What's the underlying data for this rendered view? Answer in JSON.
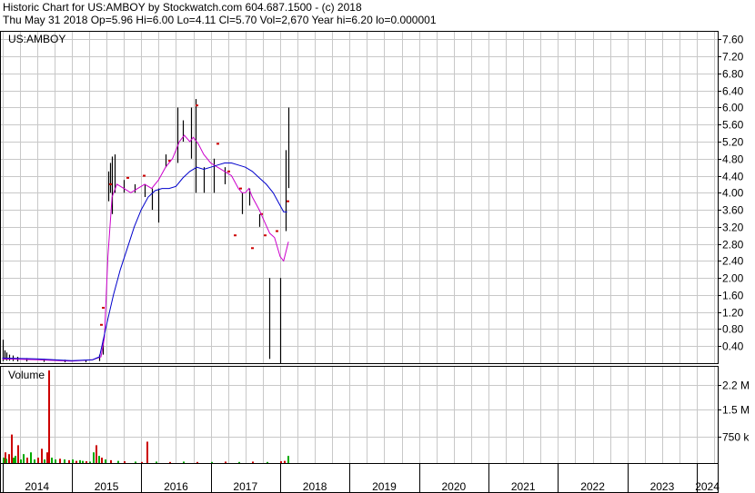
{
  "header": {
    "line1": "Historic Chart for US:AMBOY by Stockwatch.com 604.687.1500 - (c) 2018",
    "line2": "Thu May 31 2018  Op=5.96  Hi=6.00  Lo=4.11  Cl=5.70  Vol=2,670  Year hi=6.20  lo=0.000001"
  },
  "chart_data": {
    "type": "ohlc",
    "symbol_label": "US:AMBOY",
    "volume_label": "Volume",
    "price_axis": {
      "min": 0,
      "max": 7.8,
      "ticks": [
        0.4,
        0.8,
        1.2,
        1.6,
        2.0,
        2.4,
        2.8,
        3.2,
        3.6,
        4.0,
        4.4,
        4.8,
        5.2,
        5.6,
        6.0,
        6.4,
        6.8,
        7.2,
        7.6
      ],
      "tick_labels": [
        "0.40",
        "0.80",
        "1.20",
        "1.60",
        "2.00",
        "2.40",
        "2.80",
        "3.20",
        "3.60",
        "4.00",
        "4.40",
        "4.80",
        "5.20",
        "5.60",
        "6.00",
        "6.40",
        "6.80",
        "7.20",
        "7.60"
      ]
    },
    "volume_axis": {
      "min": 0,
      "max": 2600000,
      "ticks": [
        750000,
        1500000,
        2200000
      ],
      "tick_labels": [
        "750 k",
        "1.5 M",
        "2.2 M"
      ]
    },
    "time_axis": {
      "start": 2013.98,
      "end": 2024.3,
      "year_labels": [
        "2014",
        "2015",
        "2016",
        "2017",
        "2018",
        "2019",
        "2020",
        "2021",
        "2022",
        "2023",
        "2024"
      ]
    },
    "grid": true,
    "price_bars": [
      {
        "t": 2014.0,
        "h": 0.55,
        "l": 0.05
      },
      {
        "t": 2014.03,
        "h": 0.3,
        "l": 0.08
      },
      {
        "t": 2014.06,
        "h": 0.25,
        "l": 0.06
      },
      {
        "t": 2014.1,
        "h": 0.2,
        "l": 0.06
      },
      {
        "t": 2014.15,
        "h": 0.18,
        "l": 0.05
      },
      {
        "t": 2014.22,
        "h": 0.15,
        "l": 0.04
      },
      {
        "t": 2014.35,
        "h": 0.12,
        "l": 0.04
      },
      {
        "t": 2014.6,
        "h": 0.1,
        "l": 0.03
      },
      {
        "t": 2014.9,
        "h": 0.08,
        "l": 0.02
      },
      {
        "t": 2015.2,
        "h": 0.06,
        "l": 0.02
      },
      {
        "t": 2015.4,
        "h": 0.2,
        "l": 0.05
      },
      {
        "t": 2015.45,
        "h": 0.55,
        "l": 0.2
      },
      {
        "t": 2015.52,
        "h": 4.5,
        "l": 3.8
      },
      {
        "t": 2015.55,
        "h": 4.7,
        "l": 4.0
      },
      {
        "t": 2015.58,
        "h": 4.85,
        "l": 3.5
      },
      {
        "t": 2015.62,
        "h": 4.9,
        "l": 4.0
      },
      {
        "t": 2015.75,
        "h": 4.3,
        "l": 4.0
      },
      {
        "t": 2015.9,
        "h": 4.2,
        "l": 4.0
      },
      {
        "t": 2016.05,
        "h": 4.2,
        "l": 3.9
      },
      {
        "t": 2016.15,
        "h": 4.1,
        "l": 3.6
      },
      {
        "t": 2016.25,
        "h": 4.1,
        "l": 3.3
      },
      {
        "t": 2016.35,
        "h": 4.9,
        "l": 4.6
      },
      {
        "t": 2016.52,
        "h": 6.0,
        "l": 4.7
      },
      {
        "t": 2016.6,
        "h": 5.7,
        "l": 5.2
      },
      {
        "t": 2016.72,
        "h": 6.0,
        "l": 4.8
      },
      {
        "t": 2016.78,
        "h": 6.2,
        "l": 4.0
      },
      {
        "t": 2016.9,
        "h": 4.6,
        "l": 4.0
      },
      {
        "t": 2017.05,
        "h": 4.8,
        "l": 4.0
      },
      {
        "t": 2017.2,
        "h": 4.6,
        "l": 4.2
      },
      {
        "t": 2017.45,
        "h": 4.0,
        "l": 3.5
      },
      {
        "t": 2017.55,
        "h": 4.1,
        "l": 3.7
      },
      {
        "t": 2017.7,
        "h": 3.5,
        "l": 3.2
      },
      {
        "t": 2017.85,
        "h": 2.0,
        "l": 0.1
      },
      {
        "t": 2018.0,
        "h": 2.0,
        "l": 0.0
      },
      {
        "t": 2018.08,
        "h": 5.0,
        "l": 3.1
      },
      {
        "t": 2018.12,
        "h": 6.0,
        "l": 4.11
      }
    ],
    "price_dots": [
      {
        "t": 2015.42,
        "v": 0.9
      },
      {
        "t": 2015.45,
        "v": 1.3
      },
      {
        "t": 2015.55,
        "v": 4.2
      },
      {
        "t": 2015.8,
        "v": 4.35
      },
      {
        "t": 2016.03,
        "v": 4.4
      },
      {
        "t": 2016.4,
        "v": 4.75
      },
      {
        "t": 2016.8,
        "v": 6.05
      },
      {
        "t": 2017.1,
        "v": 5.15
      },
      {
        "t": 2017.25,
        "v": 4.5
      },
      {
        "t": 2017.35,
        "v": 3.0
      },
      {
        "t": 2017.43,
        "v": 4.1
      },
      {
        "t": 2017.6,
        "v": 2.7
      },
      {
        "t": 2017.72,
        "v": 3.5
      },
      {
        "t": 2017.78,
        "v": 3.0
      },
      {
        "t": 2017.95,
        "v": 3.1
      },
      {
        "t": 2018.1,
        "v": 3.8
      }
    ],
    "series": [
      {
        "color": "#cc00cc",
        "t": [
          2014.0,
          2014.5,
          2015.0,
          2015.3,
          2015.42,
          2015.47,
          2015.52,
          2015.58,
          2015.65,
          2015.75,
          2015.85,
          2015.95,
          2016.05,
          2016.15,
          2016.25,
          2016.35,
          2016.45,
          2016.5,
          2016.55,
          2016.62,
          2016.7,
          2016.75,
          2016.82,
          2016.9,
          2017.0,
          2017.1,
          2017.2,
          2017.3,
          2017.4,
          2017.45,
          2017.5,
          2017.55,
          2017.6,
          2017.7,
          2017.78,
          2017.85,
          2017.92,
          2018.0,
          2018.05,
          2018.12
        ],
        "values": [
          0.1,
          0.08,
          0.05,
          0.08,
          0.15,
          0.6,
          2.5,
          3.9,
          4.2,
          4.1,
          4.0,
          4.1,
          4.2,
          4.1,
          4.3,
          4.6,
          4.8,
          5.0,
          5.2,
          5.35,
          5.2,
          5.3,
          5.15,
          4.9,
          4.7,
          4.6,
          4.5,
          4.4,
          4.1,
          4.0,
          4.0,
          4.1,
          3.9,
          3.6,
          3.3,
          3.05,
          2.95,
          2.5,
          2.4,
          2.85
        ]
      },
      {
        "color": "#0000cc",
        "t": [
          2014.0,
          2014.5,
          2015.0,
          2015.3,
          2015.4,
          2015.5,
          2015.6,
          2015.7,
          2015.8,
          2015.9,
          2016.0,
          2016.1,
          2016.2,
          2016.3,
          2016.4,
          2016.5,
          2016.6,
          2016.7,
          2016.8,
          2016.9,
          2017.0,
          2017.1,
          2017.2,
          2017.3,
          2017.4,
          2017.5,
          2017.6,
          2017.7,
          2017.8,
          2017.9,
          2018.0,
          2018.05,
          2018.1
        ],
        "values": [
          0.12,
          0.1,
          0.06,
          0.08,
          0.15,
          0.9,
          1.6,
          2.2,
          2.7,
          3.2,
          3.6,
          3.9,
          4.05,
          4.1,
          4.1,
          4.15,
          4.35,
          4.5,
          4.6,
          4.55,
          4.6,
          4.65,
          4.7,
          4.7,
          4.65,
          4.6,
          4.5,
          4.35,
          4.2,
          4.0,
          3.7,
          3.55,
          3.55
        ]
      }
    ],
    "volume_bars": [
      {
        "t": 2014.0,
        "v": 150000,
        "c": "#00aa00"
      },
      {
        "t": 2014.03,
        "v": 300000,
        "c": "#cc0000"
      },
      {
        "t": 2014.05,
        "v": 120000,
        "c": "#00aa00"
      },
      {
        "t": 2014.08,
        "v": 250000,
        "c": "#cc0000"
      },
      {
        "t": 2014.12,
        "v": 800000,
        "c": "#cc0000"
      },
      {
        "t": 2014.15,
        "v": 150000,
        "c": "#00aa00"
      },
      {
        "t": 2014.18,
        "v": 200000,
        "c": "#00aa00"
      },
      {
        "t": 2014.22,
        "v": 500000,
        "c": "#cc0000"
      },
      {
        "t": 2014.26,
        "v": 100000,
        "c": "#00aa00"
      },
      {
        "t": 2014.3,
        "v": 250000,
        "c": "#00aa00"
      },
      {
        "t": 2014.35,
        "v": 150000,
        "c": "#cc0000"
      },
      {
        "t": 2014.4,
        "v": 300000,
        "c": "#00aa00"
      },
      {
        "t": 2014.45,
        "v": 100000,
        "c": "#00aa00"
      },
      {
        "t": 2014.5,
        "v": 150000,
        "c": "#cc0000"
      },
      {
        "t": 2014.55,
        "v": 400000,
        "c": "#cc0000"
      },
      {
        "t": 2014.6,
        "v": 100000,
        "c": "#00aa00"
      },
      {
        "t": 2014.63,
        "v": 300000,
        "c": "#cc0000"
      },
      {
        "t": 2014.66,
        "v": 2600000,
        "c": "#cc0000"
      },
      {
        "t": 2014.7,
        "v": 150000,
        "c": "#00aa00"
      },
      {
        "t": 2014.75,
        "v": 100000,
        "c": "#00aa00"
      },
      {
        "t": 2014.82,
        "v": 120000,
        "c": "#cc0000"
      },
      {
        "t": 2014.88,
        "v": 100000,
        "c": "#00aa00"
      },
      {
        "t": 2014.95,
        "v": 80000,
        "c": "#cc0000"
      },
      {
        "t": 2015.0,
        "v": 100000,
        "c": "#00aa00"
      },
      {
        "t": 2015.05,
        "v": 60000,
        "c": "#cc0000"
      },
      {
        "t": 2015.1,
        "v": 80000,
        "c": "#00aa00"
      },
      {
        "t": 2015.15,
        "v": 60000,
        "c": "#00aa00"
      },
      {
        "t": 2015.2,
        "v": 50000,
        "c": "#cc0000"
      },
      {
        "t": 2015.25,
        "v": 40000,
        "c": "#00aa00"
      },
      {
        "t": 2015.3,
        "v": 300000,
        "c": "#00aa00"
      },
      {
        "t": 2015.34,
        "v": 500000,
        "c": "#cc0000"
      },
      {
        "t": 2015.38,
        "v": 200000,
        "c": "#00aa00"
      },
      {
        "t": 2015.42,
        "v": 150000,
        "c": "#cc0000"
      },
      {
        "t": 2015.47,
        "v": 100000,
        "c": "#00aa00"
      },
      {
        "t": 2015.55,
        "v": 80000,
        "c": "#cc0000"
      },
      {
        "t": 2015.65,
        "v": 60000,
        "c": "#00aa00"
      },
      {
        "t": 2015.75,
        "v": 50000,
        "c": "#cc0000"
      },
      {
        "t": 2015.9,
        "v": 40000,
        "c": "#00aa00"
      },
      {
        "t": 2016.0,
        "v": 30000,
        "c": "#cc0000"
      },
      {
        "t": 2016.08,
        "v": 600000,
        "c": "#cc0000"
      },
      {
        "t": 2016.2,
        "v": 40000,
        "c": "#00aa00"
      },
      {
        "t": 2016.4,
        "v": 30000,
        "c": "#cc0000"
      },
      {
        "t": 2016.6,
        "v": 40000,
        "c": "#00aa00"
      },
      {
        "t": 2016.8,
        "v": 30000,
        "c": "#cc0000"
      },
      {
        "t": 2017.0,
        "v": 30000,
        "c": "#00aa00"
      },
      {
        "t": 2017.2,
        "v": 40000,
        "c": "#cc0000"
      },
      {
        "t": 2017.4,
        "v": 30000,
        "c": "#00aa00"
      },
      {
        "t": 2017.6,
        "v": 40000,
        "c": "#cc0000"
      },
      {
        "t": 2017.8,
        "v": 30000,
        "c": "#00aa00"
      },
      {
        "t": 2018.0,
        "v": 50000,
        "c": "#cc0000"
      },
      {
        "t": 2018.05,
        "v": 60000,
        "c": "#cc0000"
      },
      {
        "t": 2018.1,
        "v": 200000,
        "c": "#00aa00"
      }
    ],
    "colors": {
      "bar": "#000000",
      "up_tick": "#cc0000",
      "grid": "#c8c8c8",
      "axis": "#000000"
    }
  }
}
